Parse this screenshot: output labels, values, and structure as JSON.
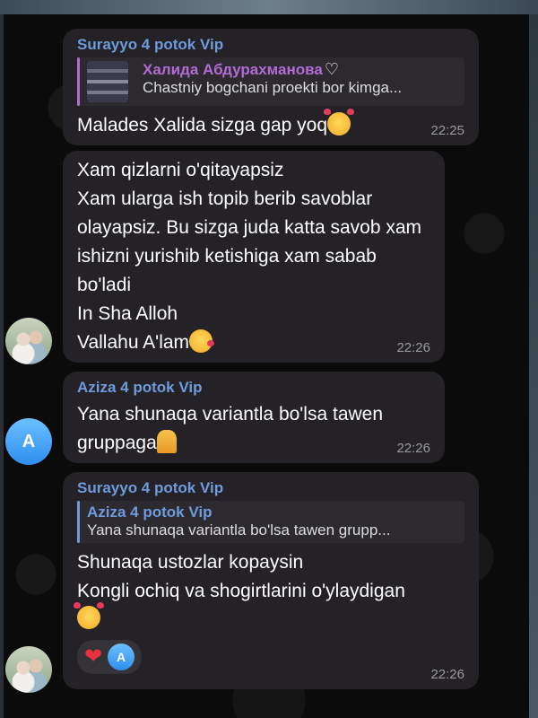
{
  "messages": [
    {
      "sender": "Surayyo 4 potok Vip",
      "reply": {
        "sender": "Халида Абдурахманова",
        "text": "Chastniy bogchani proekti bor kimga..."
      },
      "text": "Malades Xalida sizga gap yoq",
      "emoji": "smiling-face-with-hearts",
      "time": "22:25"
    },
    {
      "text": "Xam qizlarni o'qitayapsiz\nXam ularga ish topib berib savoblar olayapsiz. Bu sizga juda katta savob xam ishizni yurishib ketishiga xam sabab bo'ladi\nIn Sha Alloh\nVallahu A'lam",
      "emoji": "face-blowing-kiss",
      "time": "22:26"
    },
    {
      "sender": "Aziza 4 potok Vip",
      "text": "Yana shunaqa variantla bo'lsa tawen gruppaga",
      "emoji": "folded-hands",
      "time": "22:26",
      "avatar_letter": "A"
    },
    {
      "sender": "Surayyo 4 potok Vip",
      "reply": {
        "sender": "Aziza 4 potok Vip",
        "text": "Yana shunaqa variantla bo'lsa tawen grupp..."
      },
      "text": "Shunaqa ustozlar kopaysin\nKongli ochiq va shogirtlarini o'ylaydigan",
      "emoji": "smiling-face-with-hearts",
      "time": "22:26",
      "reactions": [
        {
          "type": "heart",
          "color": "#e8303f",
          "by": "A"
        }
      ]
    }
  ],
  "colors": {
    "bubble": "#242226",
    "sender_name": "#6f9bdc",
    "reply_accent_purple": "#b36bd6",
    "timestamp": "#9a9a9a"
  }
}
